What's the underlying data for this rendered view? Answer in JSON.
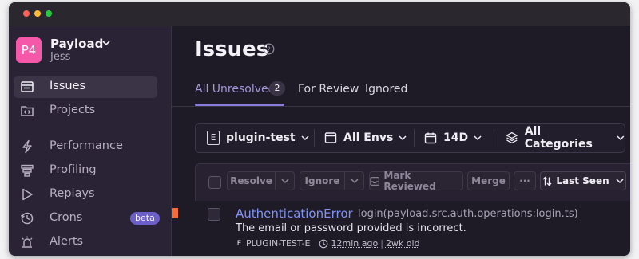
{
  "org": {
    "avatar": "P4",
    "name": "Payload",
    "user": "Jess"
  },
  "sidebar": {
    "items": [
      {
        "label": "Issues",
        "icon": "issues-icon"
      },
      {
        "label": "Projects",
        "icon": "projects-icon"
      },
      {
        "label": "Performance",
        "icon": "lightning-icon"
      },
      {
        "label": "Profiling",
        "icon": "profiling-icon"
      },
      {
        "label": "Replays",
        "icon": "play-icon"
      },
      {
        "label": "Crons",
        "icon": "clock-icon",
        "badge": "beta"
      },
      {
        "label": "Alerts",
        "icon": "siren-icon"
      }
    ]
  },
  "page": {
    "title": "Issues"
  },
  "tabs": [
    {
      "label": "All Unresolved",
      "count": "2"
    },
    {
      "label": "For Review"
    },
    {
      "label": "Ignored"
    }
  ],
  "filters": {
    "project": {
      "badge": "E",
      "label": "plugin-test"
    },
    "environment": {
      "label": "All Envs"
    },
    "date": {
      "label": "14D"
    },
    "category": {
      "label": "All Categories"
    }
  },
  "actions": {
    "resolve": "Resolve",
    "ignore": "Ignore",
    "mark_reviewed": "Mark Reviewed",
    "merge": "Merge",
    "more": "···",
    "sort": "Last Seen"
  },
  "issue": {
    "title": "AuthenticationError",
    "culprit": "login(payload.src.auth.operations:login.ts)",
    "message": "The email or password provided is incorrect.",
    "project_badge": "E",
    "short_id": "PLUGIN-TEST-E",
    "last_seen": "12min ago",
    "first_seen": "2wk old"
  },
  "colors": {
    "accent": "#8a7bdc",
    "brand_avatar": "#f558a8",
    "link": "#7f92f5",
    "priority": "#f26d3a"
  }
}
